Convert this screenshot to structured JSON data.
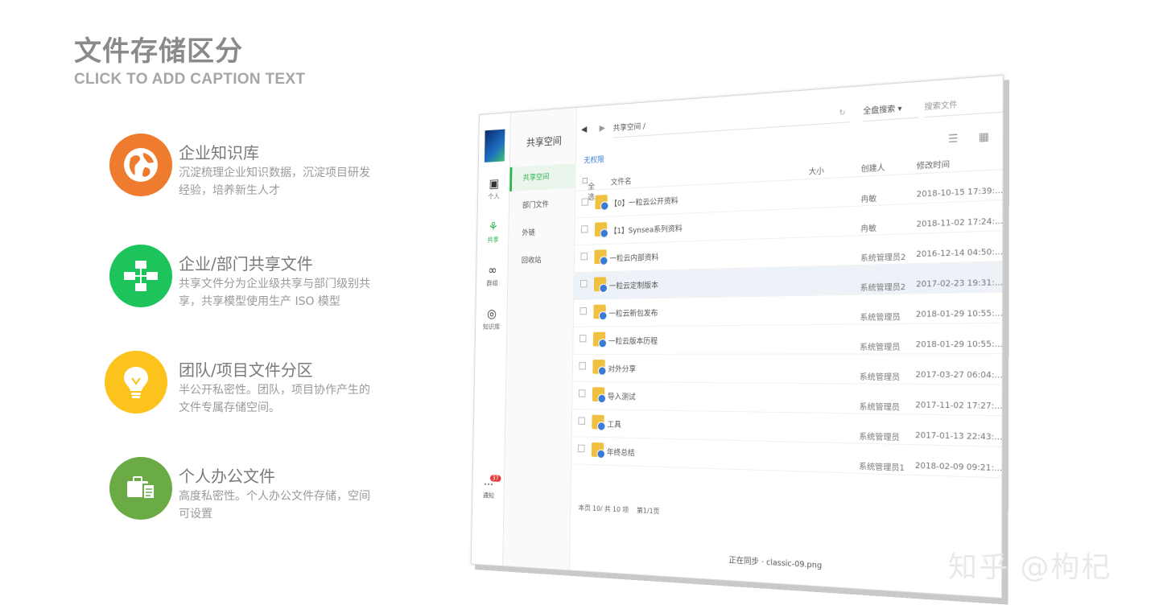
{
  "slide": {
    "title": "文件存储区分",
    "caption": "CLICK TO ADD CAPTION TEXT",
    "features": [
      {
        "title": "企业知识库",
        "desc": "沉淀梳理企业知识数据，沉淀项目研发经验，培养新生人才",
        "color": "#EE7B2E",
        "icon": "globe-icon"
      },
      {
        "title": "企业/部门共享文件",
        "desc": "共享文件分为企业级共享与部门级别共享，共享模型使用生产 ISO 模型",
        "color": "#1DC45B",
        "icon": "network-icon"
      },
      {
        "title": "团队/项目文件分区",
        "desc": "半公开私密性。团队，项目协作产生的文件专属存储空间。",
        "color": "#FBC31B",
        "icon": "lightbulb-icon"
      },
      {
        "title": "个人办公文件",
        "desc": "高度私密性。个人办公文件存储，空间可设置",
        "color": "#6AAB45",
        "icon": "briefcase-icon"
      }
    ]
  },
  "app": {
    "rail": [
      {
        "label": "个人",
        "icon": "wallet-icon",
        "glyph": "▣"
      },
      {
        "label": "共享",
        "icon": "share-icon",
        "glyph": "⚘"
      },
      {
        "label": "群组",
        "icon": "group-icon",
        "glyph": "∞"
      },
      {
        "label": "知识库",
        "icon": "compass-icon",
        "glyph": "◎"
      }
    ],
    "notice": {
      "label": "通知",
      "count": "37"
    },
    "sidebar": {
      "header": "共享空间",
      "items": [
        "共享空间",
        "部门文件",
        "外链",
        "回收站"
      ]
    },
    "toolbar": {
      "path": "共享空间 /",
      "scope": "全盘搜索 ▾",
      "search_placeholder": "搜索文件"
    },
    "permission": "无权限",
    "columns": {
      "select_all": "全选",
      "name": "文件名",
      "size": "大小",
      "creator": "创建人",
      "modified": "修改时间"
    },
    "rows": [
      {
        "name": "【0】一粒云公开资料",
        "creator": "冉敏",
        "time": "2018-10-15 17:39:..."
      },
      {
        "name": "【1】Synsea系列资料",
        "creator": "冉敏",
        "time": "2018-11-02 17:24:..."
      },
      {
        "name": "一粒云内部资料",
        "creator": "系统管理员2",
        "time": "2016-12-14 04:50:..."
      },
      {
        "name": "一粒云定制版本",
        "creator": "系统管理员2",
        "time": "2017-02-23 19:31:..."
      },
      {
        "name": "一粒云新包发布",
        "creator": "系统管理员",
        "time": "2018-01-29 10:55:..."
      },
      {
        "name": "一粒云版本历程",
        "creator": "系统管理员",
        "time": "2018-01-29 10:55:..."
      },
      {
        "name": "对外分享",
        "creator": "系统管理员",
        "time": "2017-03-27 06:04:..."
      },
      {
        "name": "导入测试",
        "creator": "系统管理员",
        "time": "2017-11-02 17:27:..."
      },
      {
        "name": "工具",
        "creator": "系统管理员",
        "time": "2017-01-13 22:43:..."
      },
      {
        "name": "年终总结",
        "creator": "系统管理员1",
        "time": "2018-02-09 09:21:..."
      }
    ],
    "footer": {
      "summary": "本页 10/ 共 10 项",
      "pages": "第1/1页"
    },
    "bottombar": "正在同步 · classic-09.png"
  },
  "watermark": "知乎 @枸杞"
}
